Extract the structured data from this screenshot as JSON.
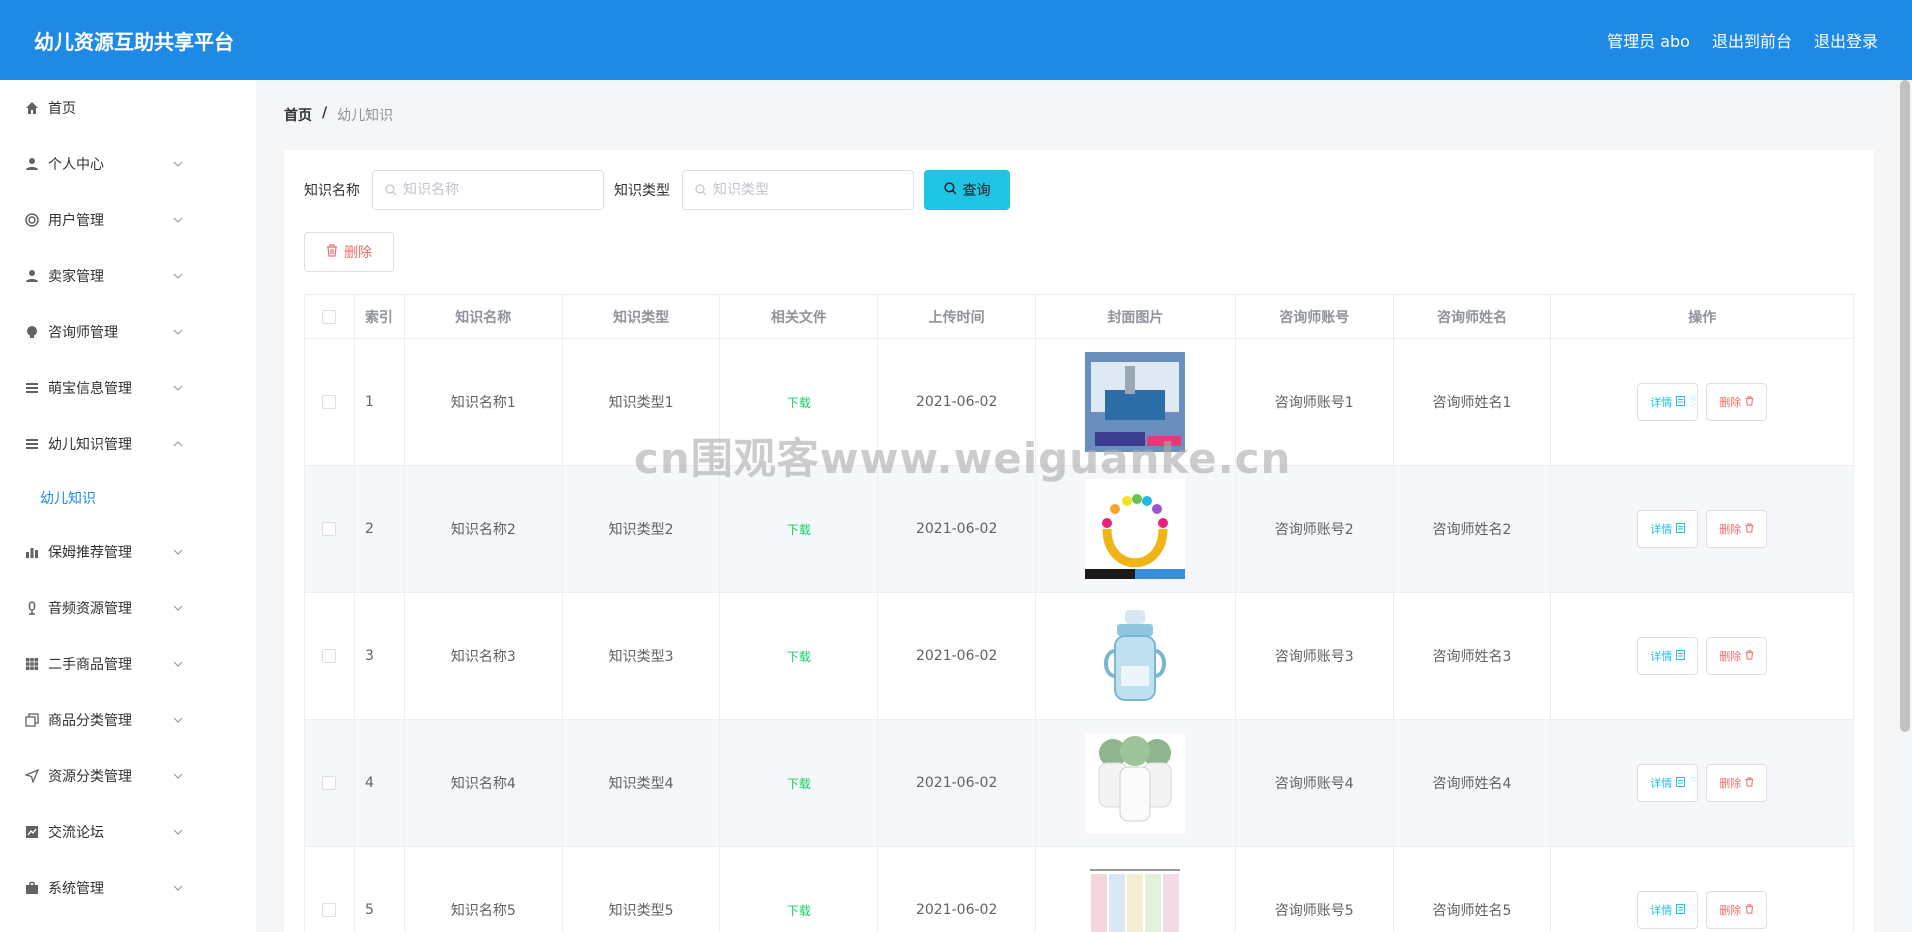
{
  "header": {
    "title": "幼儿资源互助共享平台",
    "admin_label": "管理员 abo",
    "to_front": "退出到前台",
    "logout": "退出登录"
  },
  "sidebar": {
    "items": [
      {
        "label": "首页",
        "icon": "home-icon"
      },
      {
        "label": "个人中心",
        "icon": "user-icon"
      },
      {
        "label": "用户管理",
        "icon": "lifebuoy-icon"
      },
      {
        "label": "卖家管理",
        "icon": "user-icon"
      },
      {
        "label": "咨询师管理",
        "icon": "bulb-icon"
      },
      {
        "label": "萌宝信息管理",
        "icon": "list-icon"
      },
      {
        "label": "幼儿知识管理",
        "icon": "list-icon"
      },
      {
        "label": "幼儿知识",
        "icon": ""
      },
      {
        "label": "保姆推荐管理",
        "icon": "bar-chart-icon"
      },
      {
        "label": "音频资源管理",
        "icon": "microphone-icon"
      },
      {
        "label": "二手商品管理",
        "icon": "grid-icon"
      },
      {
        "label": "商品分类管理",
        "icon": "copy-icon"
      },
      {
        "label": "资源分类管理",
        "icon": "send-icon"
      },
      {
        "label": "交流论坛",
        "icon": "line-chart-icon"
      },
      {
        "label": "系统管理",
        "icon": "briefcase-icon"
      }
    ]
  },
  "breadcrumb": {
    "home": "首页",
    "sep": "/",
    "current": "幼儿知识"
  },
  "search": {
    "name_label": "知识名称",
    "name_placeholder": "知识名称",
    "type_label": "知识类型",
    "type_placeholder": "知识类型",
    "query_button": "查询",
    "delete_button": "删除"
  },
  "table": {
    "headers": [
      "索引",
      "知识名称",
      "知识类型",
      "相关文件",
      "上传时间",
      "封面图片",
      "咨询师账号",
      "咨询师姓名",
      "操作"
    ],
    "rows": [
      {
        "index": "1",
        "name": "知识名称1",
        "type": "知识类型1",
        "file": "下载",
        "time": "2021-06-02",
        "account": "咨询师账号1",
        "consultant": "咨询师姓名1",
        "detail": "详情",
        "remove": "删除"
      },
      {
        "index": "2",
        "name": "知识名称2",
        "type": "知识类型2",
        "file": "下载",
        "time": "2021-06-02",
        "account": "咨询师账号2",
        "consultant": "咨询师姓名2",
        "detail": "详情",
        "remove": "删除"
      },
      {
        "index": "3",
        "name": "知识名称3",
        "type": "知识类型3",
        "file": "下载",
        "time": "2021-06-02",
        "account": "咨询师账号3",
        "consultant": "咨询师姓名3",
        "detail": "详情",
        "remove": "删除"
      },
      {
        "index": "4",
        "name": "知识名称4",
        "type": "知识类型4",
        "file": "下载",
        "time": "2021-06-02",
        "account": "咨询师账号4",
        "consultant": "咨询师姓名4",
        "detail": "详情",
        "remove": "删除"
      },
      {
        "index": "5",
        "name": "知识名称5",
        "type": "知识类型5",
        "file": "下载",
        "time": "2021-06-02",
        "account": "咨询师账号5",
        "consultant": "咨询师姓名5",
        "detail": "详情",
        "remove": "删除"
      }
    ]
  },
  "watermark": "cn围观客www.weiguanke.cn",
  "colors": {
    "primary": "#1e8ae6",
    "query": "#1fc3e3",
    "danger": "#f56c6c",
    "success": "#13ce66"
  }
}
